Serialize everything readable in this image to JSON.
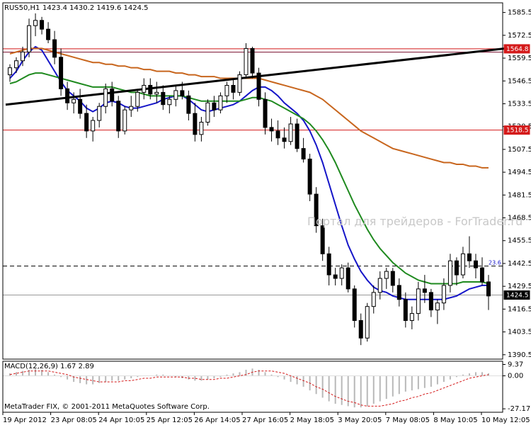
{
  "header": {
    "symbol": "RUS50,H1",
    "ohlc": "1423.4 1430.2 1419.6 1424.5"
  },
  "watermark": "Портал для трейдеров - ForTrader.ru",
  "copyright": "MetaTrader FIX, © 2001-2011 MetaQuotes Software Corp.",
  "macd_label": "MACD(12,26,9) 1.67 2.89",
  "price_tags": {
    "upper_resistance": "1564.8",
    "lower_support": "1518.5",
    "current": "1424.5",
    "fib_level": "23.6"
  },
  "colors": {
    "candles": "#000000",
    "ma_blue": "#1515c8",
    "ma_green": "#1f8a1f",
    "ma_brown": "#c8661e",
    "trendline": "#000000",
    "hline_red": "#d41a1a",
    "hline_maroon": "#7a1030",
    "macd_hist": "#b8b8b8",
    "macd_signal": "#d41a1a"
  },
  "chart_data": {
    "type": "candlestick",
    "instrument": "RUS50",
    "timeframe": "H1",
    "y_ticks": [
      1585.5,
      1572.5,
      1559.5,
      1546.5,
      1533.5,
      1520.5,
      1507.5,
      1494.5,
      1481.5,
      1468.5,
      1455.5,
      1442.5,
      1429.5,
      1416.5,
      1403.5,
      1390.5
    ],
    "ylim": [
      1388.0,
      1591.0
    ],
    "x_labels": [
      "19 Apr 2012",
      "23 Apr 08:05",
      "24 Apr 10:05",
      "25 Apr 12:05",
      "26 Apr 14:05",
      "27 Apr 16:05",
      "2 May 18:05",
      "3 May 20:05",
      "7 May 08:05",
      "8 May 10:05",
      "10 May 12:05"
    ],
    "horizontal_lines": [
      {
        "value": 1564.8,
        "style": "solid",
        "color": "#d41a1a"
      },
      {
        "value": 1562.9,
        "style": "solid",
        "color": "#7a1030"
      },
      {
        "value": 1518.5,
        "style": "solid",
        "color": "#d41a1a"
      },
      {
        "value": 1441.0,
        "style": "dashed",
        "color": "#000000",
        "label": "23.6"
      },
      {
        "value": 1424.5,
        "style": "solid",
        "color": "#9a9a9a"
      }
    ],
    "candles": [
      [
        1550,
        1556,
        1546,
        1554
      ],
      [
        1554,
        1560,
        1551,
        1558
      ],
      [
        1558,
        1566,
        1555,
        1563
      ],
      [
        1563,
        1582,
        1560,
        1578
      ],
      [
        1578,
        1585,
        1572,
        1581
      ],
      [
        1581,
        1583,
        1573,
        1576
      ],
      [
        1576,
        1580,
        1568,
        1570
      ],
      [
        1570,
        1575,
        1556,
        1560
      ],
      [
        1560,
        1565,
        1538,
        1542
      ],
      [
        1542,
        1546,
        1530,
        1534
      ],
      [
        1534,
        1540,
        1528,
        1536
      ],
      [
        1536,
        1542,
        1525,
        1528
      ],
      [
        1528,
        1533,
        1514,
        1518
      ],
      [
        1518,
        1526,
        1512,
        1524
      ],
      [
        1524,
        1534,
        1520,
        1532
      ],
      [
        1532,
        1545,
        1528,
        1542
      ],
      [
        1542,
        1546,
        1532,
        1535
      ],
      [
        1535,
        1538,
        1514,
        1518
      ],
      [
        1518,
        1532,
        1516,
        1530
      ],
      [
        1530,
        1538,
        1526,
        1532
      ],
      [
        1532,
        1542,
        1529,
        1540
      ],
      [
        1540,
        1548,
        1536,
        1544
      ],
      [
        1544,
        1548,
        1536,
        1539
      ],
      [
        1539,
        1546,
        1534,
        1540
      ],
      [
        1540,
        1544,
        1530,
        1533
      ],
      [
        1533,
        1538,
        1528,
        1536
      ],
      [
        1536,
        1544,
        1532,
        1541
      ],
      [
        1541,
        1546,
        1536,
        1538
      ],
      [
        1538,
        1541,
        1524,
        1528
      ],
      [
        1528,
        1534,
        1512,
        1516
      ],
      [
        1516,
        1526,
        1512,
        1523
      ],
      [
        1523,
        1536,
        1521,
        1534
      ],
      [
        1534,
        1538,
        1526,
        1530
      ],
      [
        1530,
        1540,
        1528,
        1538
      ],
      [
        1538,
        1546,
        1534,
        1544
      ],
      [
        1544,
        1548,
        1536,
        1540
      ],
      [
        1540,
        1552,
        1538,
        1550
      ],
      [
        1550,
        1568,
        1548,
        1565
      ],
      [
        1565,
        1566,
        1548,
        1551
      ],
      [
        1551,
        1554,
        1532,
        1536
      ],
      [
        1536,
        1540,
        1516,
        1520
      ],
      [
        1520,
        1525,
        1512,
        1518
      ],
      [
        1518,
        1524,
        1510,
        1514
      ],
      [
        1514,
        1520,
        1508,
        1512
      ],
      [
        1512,
        1526,
        1510,
        1522
      ],
      [
        1522,
        1525,
        1506,
        1508
      ],
      [
        1508,
        1514,
        1500,
        1502
      ],
      [
        1502,
        1505,
        1478,
        1482
      ],
      [
        1482,
        1486,
        1460,
        1464
      ],
      [
        1464,
        1468,
        1444,
        1448
      ],
      [
        1448,
        1452,
        1430,
        1436
      ],
      [
        1436,
        1440,
        1430,
        1434
      ],
      [
        1434,
        1442,
        1430,
        1440
      ],
      [
        1440,
        1443,
        1426,
        1428
      ],
      [
        1428,
        1430,
        1406,
        1410
      ],
      [
        1410,
        1414,
        1396,
        1400
      ],
      [
        1400,
        1420,
        1398,
        1418
      ],
      [
        1418,
        1430,
        1414,
        1426
      ],
      [
        1426,
        1438,
        1422,
        1434
      ],
      [
        1434,
        1440,
        1428,
        1438
      ],
      [
        1438,
        1440,
        1426,
        1430
      ],
      [
        1430,
        1434,
        1418,
        1422
      ],
      [
        1422,
        1426,
        1406,
        1410
      ],
      [
        1410,
        1418,
        1405,
        1414
      ],
      [
        1414,
        1432,
        1410,
        1428
      ],
      [
        1428,
        1436,
        1420,
        1426
      ],
      [
        1426,
        1428,
        1412,
        1416
      ],
      [
        1416,
        1422,
        1408,
        1420
      ],
      [
        1420,
        1434,
        1416,
        1430
      ],
      [
        1430,
        1448,
        1426,
        1444
      ],
      [
        1444,
        1446,
        1430,
        1436
      ],
      [
        1436,
        1452,
        1434,
        1448
      ],
      [
        1448,
        1458,
        1440,
        1444
      ],
      [
        1444,
        1448,
        1434,
        1440
      ],
      [
        1440,
        1446,
        1430,
        1432
      ],
      [
        1432,
        1436,
        1416,
        1424
      ]
    ],
    "moving_averages": [
      {
        "color": "#1515c8",
        "values": [
          1548,
          1552,
          1558,
          1563,
          1566,
          1564,
          1558,
          1552,
          1546,
          1541,
          1538,
          1535,
          1531,
          1529,
          1531,
          1534,
          1535,
          1534,
          1532,
          1531,
          1531,
          1532,
          1533,
          1534,
          1536,
          1537,
          1538,
          1538,
          1536,
          1533,
          1530,
          1529,
          1530,
          1531,
          1532,
          1533,
          1535,
          1538,
          1541,
          1543,
          1543,
          1541,
          1538,
          1534,
          1531,
          1528,
          1524,
          1518,
          1510,
          1500,
          1488,
          1476,
          1464,
          1453,
          1445,
          1438,
          1433,
          1429,
          1427,
          1426,
          1424,
          1423,
          1422,
          1422,
          1422,
          1422,
          1422,
          1422,
          1422,
          1423,
          1424,
          1426,
          1428,
          1429,
          1430,
          1430
        ]
      },
      {
        "color": "#1f8a1f",
        "values": [
          1545,
          1546,
          1548,
          1550,
          1551,
          1551,
          1550,
          1549,
          1548,
          1547,
          1546,
          1545,
          1544,
          1543,
          1543,
          1543,
          1543,
          1542,
          1541,
          1540,
          1540,
          1539,
          1538,
          1538,
          1538,
          1538,
          1538,
          1538,
          1537,
          1536,
          1535,
          1535,
          1535,
          1535,
          1535,
          1535,
          1535,
          1536,
          1537,
          1537,
          1536,
          1535,
          1533,
          1531,
          1529,
          1527,
          1525,
          1522,
          1518,
          1513,
          1507,
          1500,
          1492,
          1484,
          1476,
          1469,
          1462,
          1456,
          1451,
          1447,
          1443,
          1440,
          1437,
          1435,
          1433,
          1432,
          1431,
          1431,
          1431,
          1431,
          1431,
          1432,
          1432,
          1432,
          1432,
          1431
        ]
      },
      {
        "color": "#c8661e",
        "values": [
          1562,
          1563,
          1564,
          1565,
          1565,
          1565,
          1564,
          1563,
          1562,
          1561,
          1560,
          1559,
          1558,
          1557,
          1557,
          1556,
          1556,
          1555,
          1555,
          1554,
          1554,
          1553,
          1553,
          1552,
          1552,
          1552,
          1551,
          1551,
          1550,
          1550,
          1549,
          1549,
          1549,
          1548,
          1548,
          1548,
          1548,
          1548,
          1548,
          1548,
          1547,
          1546,
          1545,
          1544,
          1543,
          1542,
          1541,
          1540,
          1538,
          1536,
          1533,
          1530,
          1527,
          1524,
          1521,
          1518,
          1516,
          1514,
          1512,
          1510,
          1508,
          1507,
          1506,
          1505,
          1504,
          1503,
          1502,
          1501,
          1500,
          1500,
          1499,
          1499,
          1498,
          1498,
          1497,
          1497
        ]
      }
    ],
    "trendline": {
      "from": [
        0,
        1533.0
      ],
      "to": [
        75,
        1565.0
      ]
    },
    "macd": {
      "label": "MACD(12,26,9) 1.67 2.89",
      "y_ticks": [
        9.37,
        0.0,
        -27.17
      ],
      "ylim": [
        -30.0,
        12.0
      ],
      "histogram": [
        2,
        3,
        4,
        5,
        6,
        5,
        3,
        1,
        -1,
        -3,
        -5,
        -6,
        -7,
        -7,
        -6,
        -5,
        -4,
        -4,
        -3,
        -2,
        -1,
        0,
        0,
        1,
        1,
        0,
        -1,
        -2,
        -3,
        -4,
        -4,
        -3,
        -2,
        -1,
        1,
        2,
        3,
        5,
        6,
        5,
        3,
        1,
        -1,
        -3,
        -5,
        -7,
        -9,
        -12,
        -15,
        -18,
        -21,
        -23,
        -24,
        -25,
        -26,
        -26,
        -25,
        -23,
        -21,
        -19,
        -17,
        -15,
        -13,
        -12,
        -11,
        -10,
        -9,
        -7,
        -5,
        -3,
        -1,
        1,
        2,
        3,
        3,
        2
      ],
      "signal": [
        1,
        2,
        3,
        4,
        4,
        4,
        4,
        3,
        2,
        1,
        -1,
        -2,
        -3,
        -4,
        -5,
        -5,
        -5,
        -5,
        -4,
        -4,
        -3,
        -2,
        -2,
        -1,
        -1,
        -1,
        -1,
        -1,
        -2,
        -2,
        -3,
        -3,
        -3,
        -2,
        -2,
        -1,
        0,
        1,
        3,
        4,
        4,
        4,
        3,
        2,
        0,
        -2,
        -4,
        -6,
        -9,
        -11,
        -14,
        -17,
        -19,
        -21,
        -22,
        -24,
        -25,
        -25,
        -25,
        -24,
        -23,
        -21,
        -20,
        -18,
        -17,
        -15,
        -14,
        -12,
        -10,
        -8,
        -6,
        -4,
        -2,
        -1,
        0,
        1
      ]
    }
  }
}
